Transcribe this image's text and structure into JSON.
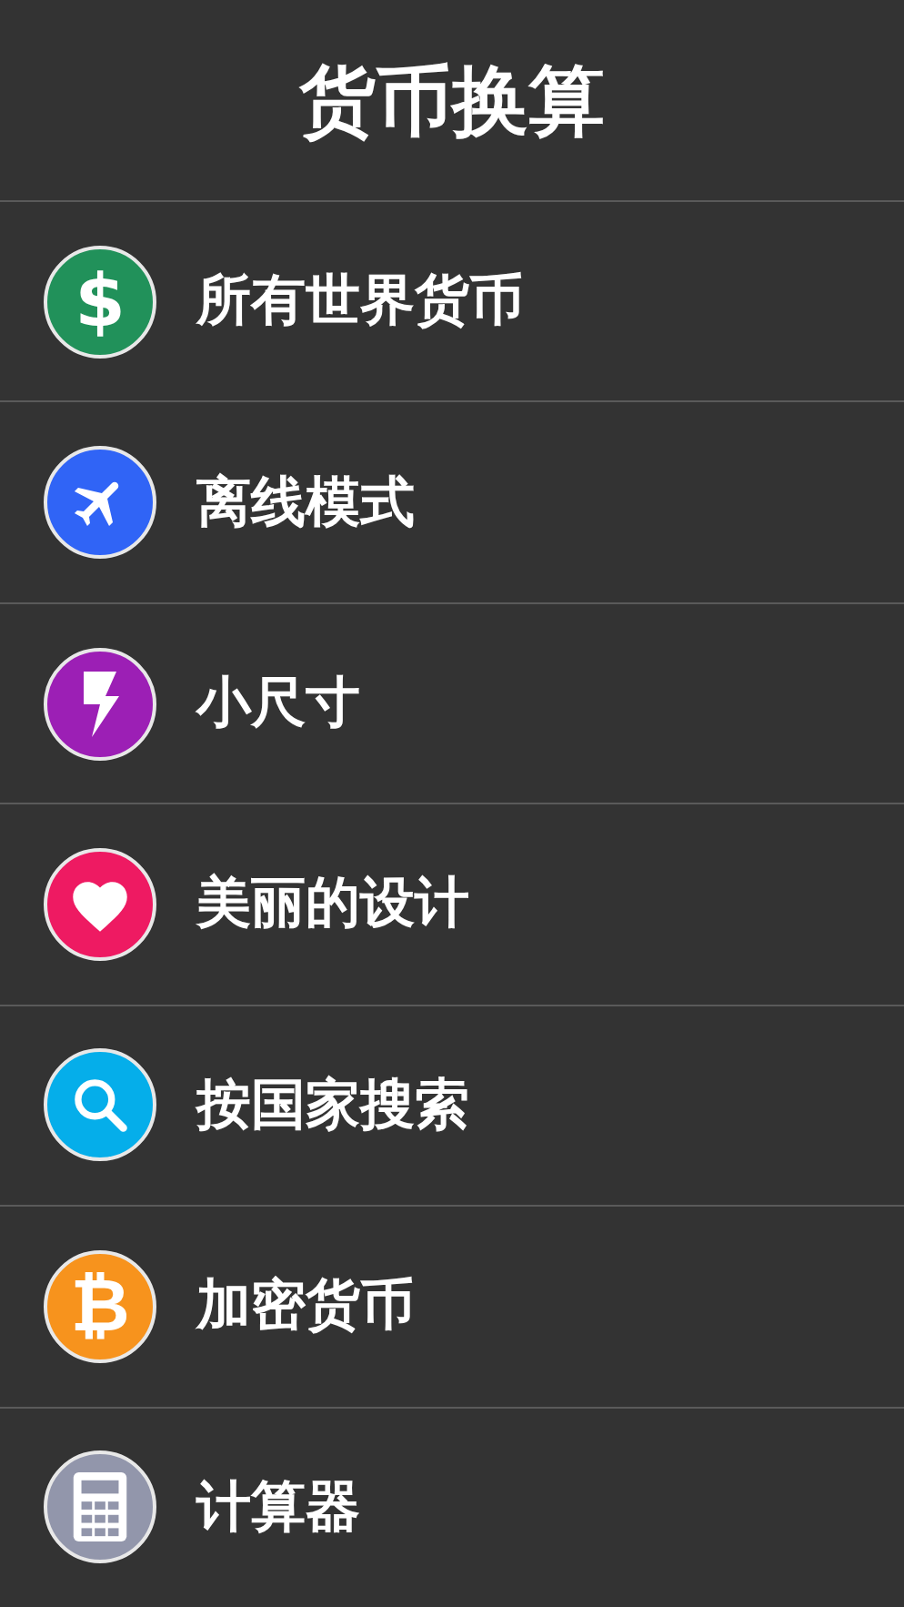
{
  "title": "货币换算",
  "features": [
    {
      "label": "所有世界货币",
      "kind": "glyph",
      "symbol": "$",
      "color": "#21915a"
    },
    {
      "label": "离线模式",
      "kind": "plane",
      "color": "#3064f6"
    },
    {
      "label": "小尺寸",
      "kind": "bolt",
      "color": "#9c1fb5"
    },
    {
      "label": "美丽的设计",
      "kind": "heart",
      "color": "#ee1a62"
    },
    {
      "label": "按国家搜索",
      "kind": "search",
      "color": "#05aeea"
    },
    {
      "label": "加密货币",
      "kind": "glyph",
      "symbol": "₿",
      "color": "#f7931d"
    },
    {
      "label": "计算器",
      "kind": "calculator",
      "color": "#9296ab"
    }
  ]
}
